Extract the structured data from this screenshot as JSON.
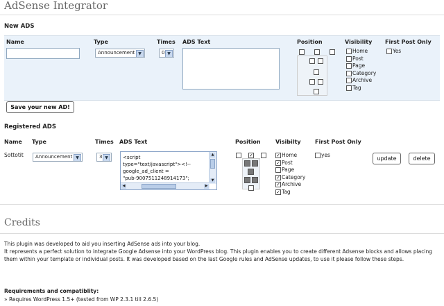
{
  "title": "AdSense Integrator",
  "new_ads": {
    "section_title": "New ADS",
    "headers": {
      "name": "Name",
      "type": "Type",
      "times": "Times",
      "ads_text": "ADS Text",
      "position": "Position",
      "visibility": "Visibility",
      "first_post": "First Post Only"
    },
    "type_value": "Announcement",
    "times_value": "0",
    "visibility_options": [
      "Home",
      "Post",
      "Page",
      "Category",
      "Archive",
      "Tag"
    ],
    "first_post_option": "Yes",
    "save_button": "Save your new AD!"
  },
  "registered_ads": {
    "section_title": "Registered ADS",
    "headers": {
      "name": "Name",
      "type": "Type",
      "times": "Times",
      "ads_text": "ADS Text",
      "position": "Position",
      "visibility": "Visibilty",
      "first_post": "First Post Only"
    },
    "row": {
      "name": "Sottotit",
      "type_value": "Announcement",
      "times_value": "3",
      "ads_lines": [
        "<script",
        "type=\"text/javascript\"><!--",
        "google_ad_client =",
        "\"pub-9007511248914173\";"
      ],
      "visibility_options": [
        "Home",
        "Post",
        "Page",
        "Category",
        "Archive",
        "Tag"
      ],
      "visibility_checked": [
        true,
        true,
        false,
        true,
        true,
        true
      ],
      "first_post_option": "yes",
      "update_button": "update",
      "delete_button": "delete"
    }
  },
  "credits": {
    "title": "Credits",
    "p1": "This plugin was developed to aid you inserting AdSense ads into your blog.",
    "p2": "It represents a perfect solution to integrate Google Adsense into your WordPress blog. This plugin enables you to create different Adsense blocks and allows placing them within your template or individual posts. It was developed based on the last Google rules and AdSense updates, to use it please follow these steps.",
    "req_title": "Requirements and compatiblity:",
    "req_item": "» Requires WordPress 1.5+ (tested from WP 2.3.1 till 2.6.5)"
  }
}
